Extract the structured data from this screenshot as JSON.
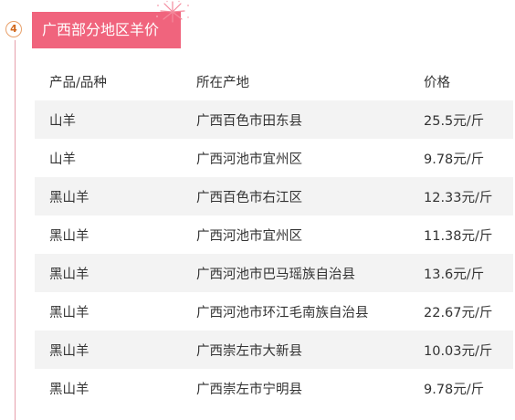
{
  "section": {
    "number": "4",
    "title": "广西部分地区羊价"
  },
  "colors": {
    "accent": "#f0647d",
    "badge": "#d2691e",
    "row_stripe": "#f3f3f3"
  },
  "table": {
    "headers": [
      "产品/品种",
      "所在产地",
      "价格"
    ],
    "rows": [
      [
        "山羊",
        "广西百色市田东县",
        "25.5元/斤"
      ],
      [
        "山羊",
        "广西河池市宜州区",
        "9.78元/斤"
      ],
      [
        "黑山羊",
        "广西百色市右江区",
        "12.33元/斤"
      ],
      [
        "黑山羊",
        "广西河池市宜州区",
        "11.38元/斤"
      ],
      [
        "黑山羊",
        "广西河池市巴马瑶族自治县",
        "13.6元/斤"
      ],
      [
        "黑山羊",
        "广西河池市环江毛南族自治县",
        "22.67元/斤"
      ],
      [
        "黑山羊",
        "广西崇左市大新县",
        "10.03元/斤"
      ],
      [
        "黑山羊",
        "广西崇左市宁明县",
        "9.78元/斤"
      ]
    ]
  }
}
